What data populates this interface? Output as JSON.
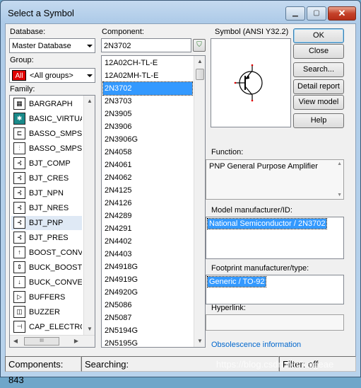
{
  "window": {
    "title": "Select a Symbol",
    "min_glyph": "▁",
    "max_glyph": "▢",
    "close_glyph": "✕"
  },
  "database": {
    "label": "Database:",
    "value": "Master Database"
  },
  "group": {
    "label": "Group:",
    "value": "<All groups>",
    "icon_text": "All"
  },
  "family": {
    "label": "Family:",
    "items": [
      {
        "label": "BARGRAPH",
        "icon": "bargraph-icon",
        "glyph": "▦"
      },
      {
        "label": "BASIC_VIRTUA",
        "icon": "basic-virtual-icon",
        "glyph": "✱"
      },
      {
        "label": "BASSO_SMPS_A",
        "icon": "basso-smps-a-icon",
        "glyph": "⊏"
      },
      {
        "label": "BASSO_SMPS_C",
        "icon": "basso-smps-c-icon",
        "glyph": "⫶"
      },
      {
        "label": "BJT_COMP",
        "icon": "bjt-comp-icon",
        "glyph": "⊰"
      },
      {
        "label": "BJT_CRES",
        "icon": "bjt-cres-icon",
        "glyph": "⊰"
      },
      {
        "label": "BJT_NPN",
        "icon": "bjt-npn-icon",
        "glyph": "⊰"
      },
      {
        "label": "BJT_NRES",
        "icon": "bjt-nres-icon",
        "glyph": "⊰"
      },
      {
        "label": "BJT_PNP",
        "icon": "bjt-pnp-icon",
        "glyph": "⊰"
      },
      {
        "label": "BJT_PRES",
        "icon": "bjt-pres-icon",
        "glyph": "⊰"
      },
      {
        "label": "BOOST_CONVE",
        "icon": "boost-converter-icon",
        "glyph": "↑"
      },
      {
        "label": "BUCK_BOOST_C",
        "icon": "buck-boost-icon",
        "glyph": "⇕"
      },
      {
        "label": "BUCK_CONVERT",
        "icon": "buck-converter-icon",
        "glyph": "↓"
      },
      {
        "label": "BUFFERS",
        "icon": "buffer-icon",
        "glyph": "▷"
      },
      {
        "label": "BUZZER",
        "icon": "buzzer-icon",
        "glyph": "◫"
      },
      {
        "label": "CAP_ELECTROL",
        "icon": "capacitor-icon",
        "glyph": "⊣"
      }
    ],
    "selected_index": 8,
    "hscroll_glyph": "III"
  },
  "component": {
    "label": "Component:",
    "search_value": "2N3702",
    "items": [
      "12A02CH-TL-E",
      "12A02MH-TL-E",
      "2N3702",
      "2N3703",
      "2N3905",
      "2N3906",
      "2N3906G",
      "2N4058",
      "2N4061",
      "2N4062",
      "2N4125",
      "2N4126",
      "2N4289",
      "2N4291",
      "2N4402",
      "2N4403",
      "2N4918G",
      "2N4919G",
      "2N4920G",
      "2N5086",
      "2N5087",
      "2N5194G",
      "2N5195G"
    ],
    "selected_index": 2
  },
  "symbol": {
    "label": "Symbol (ANSI Y32.2)"
  },
  "buttons": {
    "ok": "OK",
    "close": "Close",
    "search": "Search...",
    "detail": "Detail report",
    "view_model": "View model",
    "help": "Help"
  },
  "function": {
    "label": "Function:",
    "value": "PNP General Purpose Amplifier"
  },
  "model": {
    "label": "Model manufacturer/ID:",
    "value": "National Semiconductor / 2N3702"
  },
  "footprint": {
    "label": "Footprint manufacturer/type:",
    "value": "Generic / TO-92"
  },
  "hyperlink": {
    "label": "Hyperlink:",
    "value": ""
  },
  "obsolescence": {
    "label": "Obsolescence information"
  },
  "status": {
    "components": "Components: 843",
    "searching": "Searching:",
    "filter": "Filter: off"
  },
  "watermark": "https://blog.csdn.net/haigeae",
  "colors": {
    "selection": "#3399ff",
    "link": "#0066cc"
  }
}
